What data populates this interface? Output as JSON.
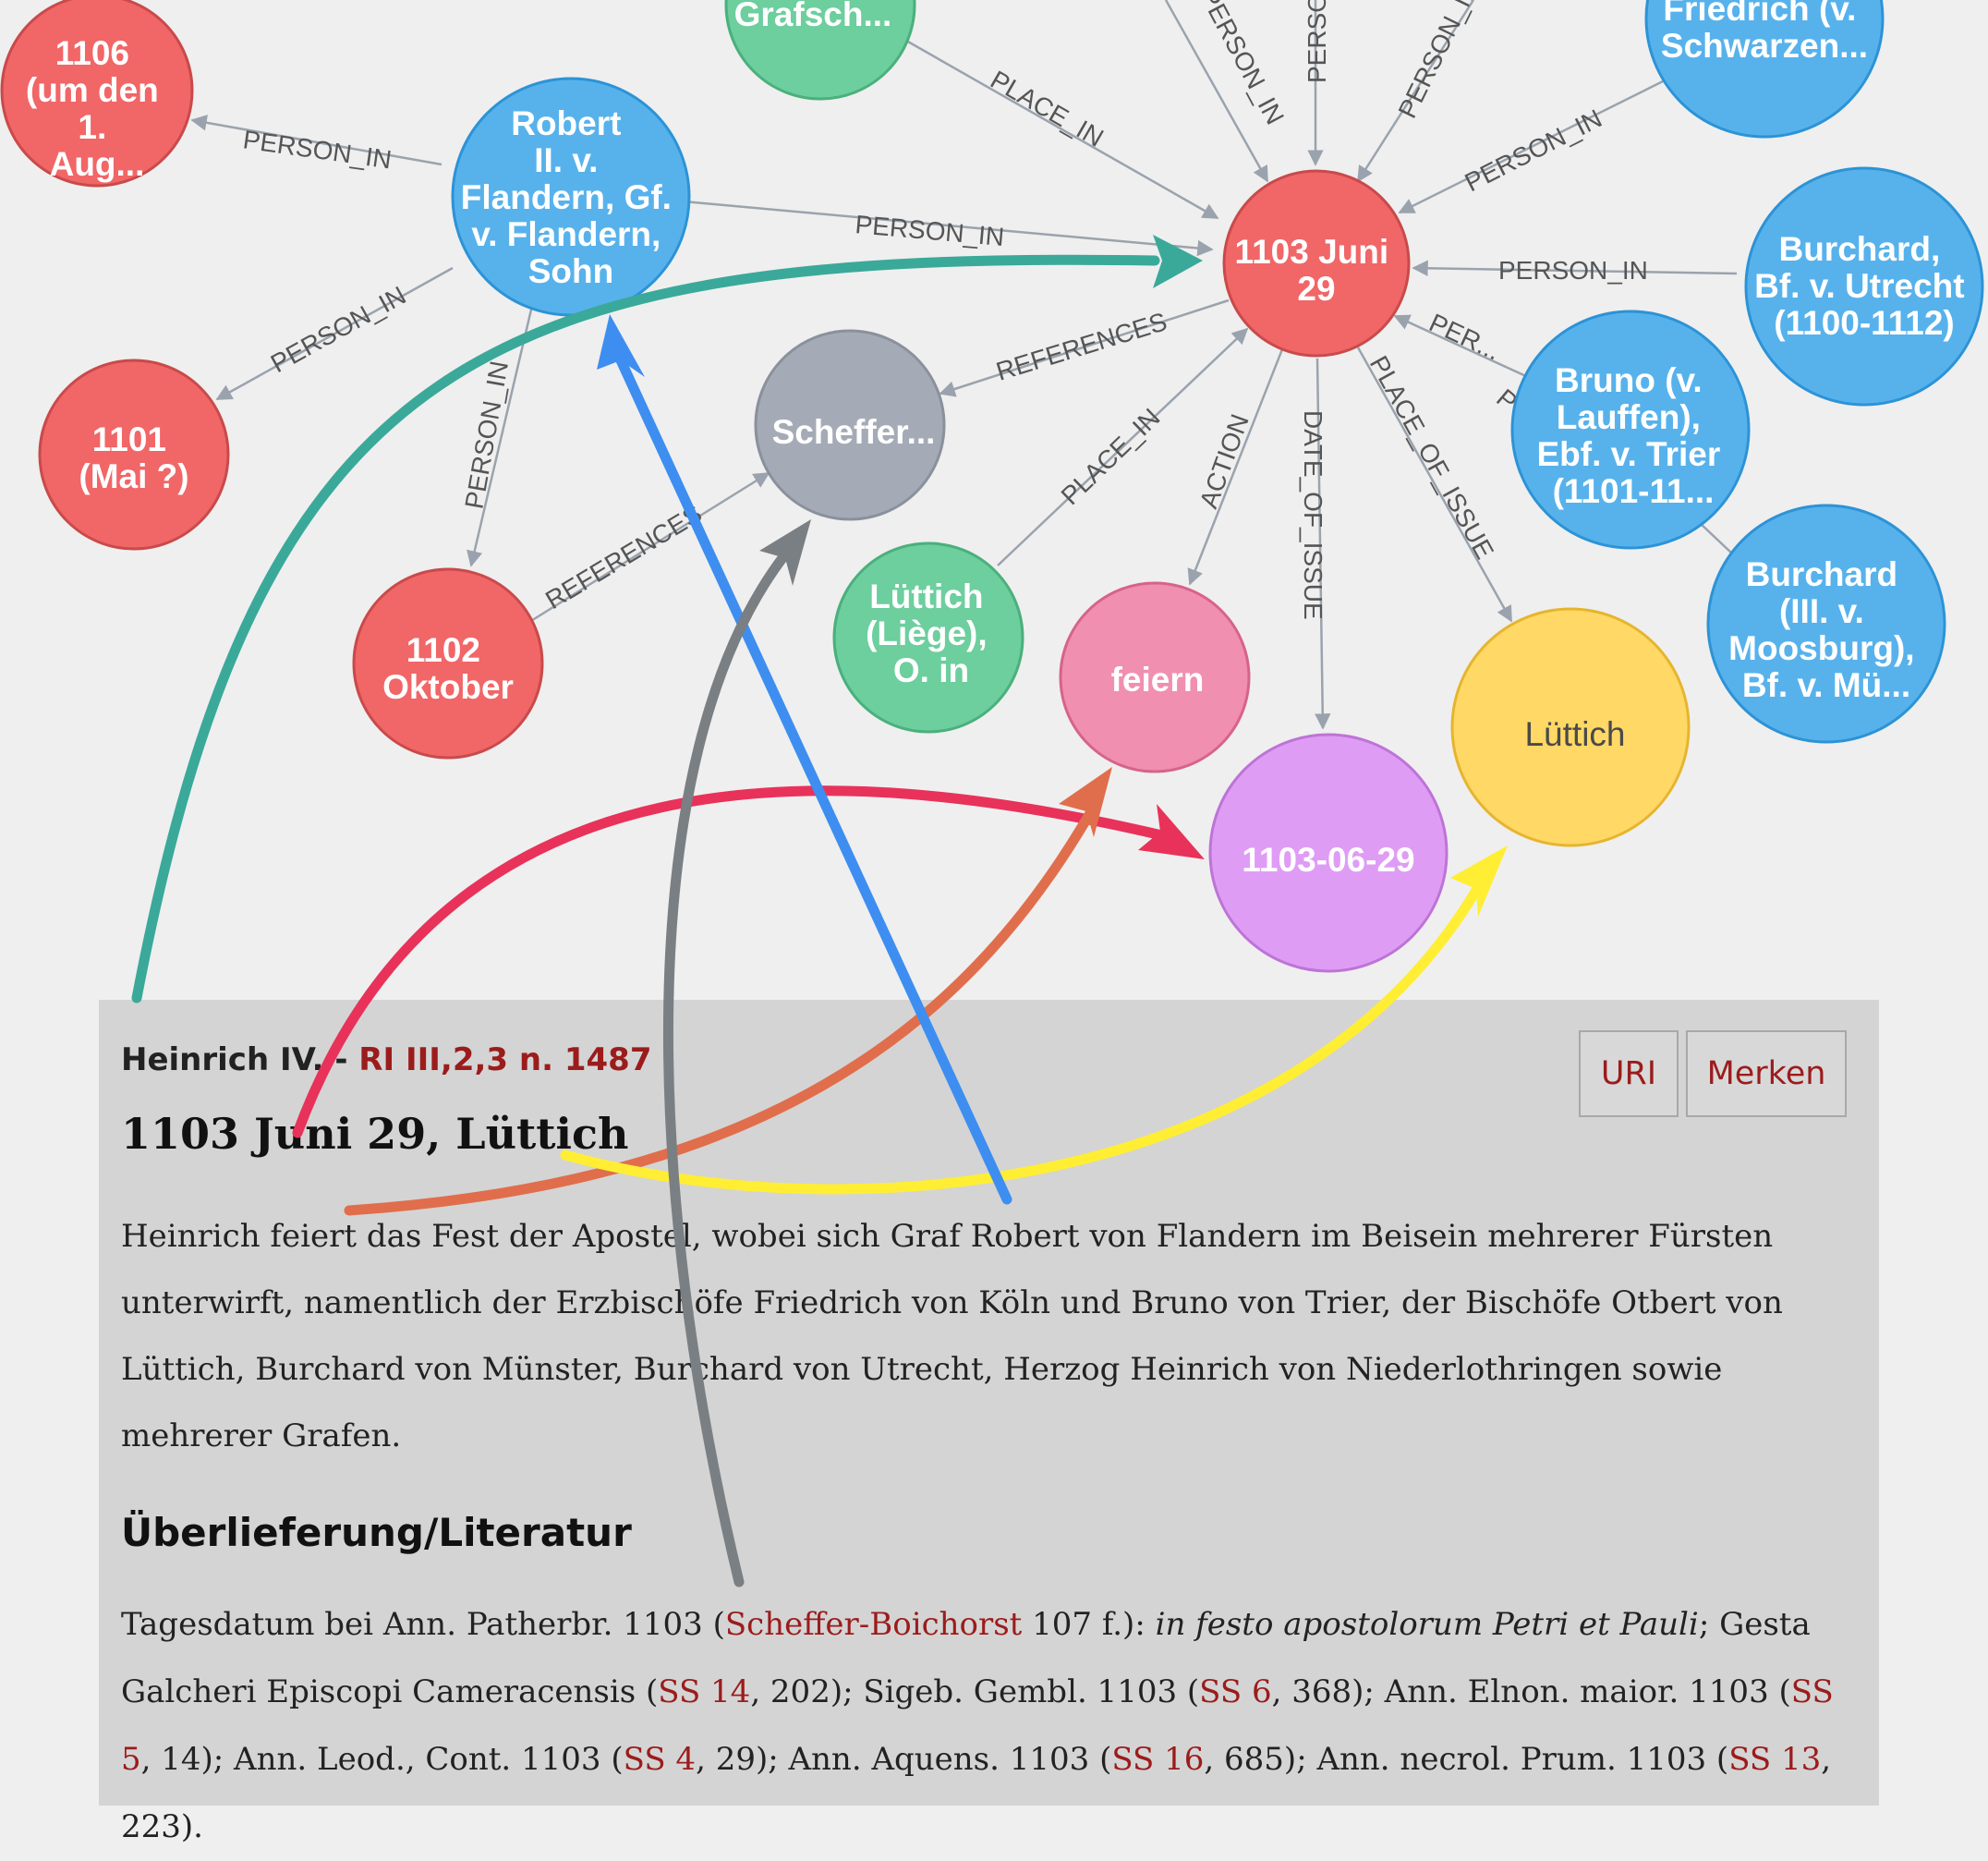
{
  "graph": {
    "nodes": [
      {
        "id": "n1106",
        "lines": [
          "1106",
          "(um den",
          "1.",
          "Aug..."
        ],
        "color": "#f16667",
        "dark": false
      },
      {
        "id": "robert",
        "lines": [
          "Robert",
          "II. v.",
          "Flandern, Gf.",
          "v. Flandern,",
          "Sohn"
        ],
        "color": "#57b2ec",
        "dark": false
      },
      {
        "id": "grafsch",
        "lines": [
          "Grafsch..."
        ],
        "color": "#6dce9e",
        "dark": false
      },
      {
        "id": "main",
        "lines": [
          "1103 Juni",
          "29"
        ],
        "color": "#f16667",
        "dark": false
      },
      {
        "id": "friedrich",
        "lines": [
          "Friedrich (v.",
          "Schwarzen..."
        ],
        "color": "#57b2ec",
        "dark": false
      },
      {
        "id": "burchard_utrecht",
        "lines": [
          "Burchard,",
          "Bf. v. Utrecht",
          "(1100-1112)"
        ],
        "color": "#57b2ec",
        "dark": false
      },
      {
        "id": "n1101",
        "lines": [
          "1101",
          "(Mai ?)"
        ],
        "color": "#f16667",
        "dark": false
      },
      {
        "id": "scheffer",
        "lines": [
          "Scheffer..."
        ],
        "color": "#a5abb6",
        "dark": false
      },
      {
        "id": "bruno",
        "lines": [
          "Bruno (v.",
          "Lauffen),",
          "Ebf. v. Trier",
          "(1101-11..."
        ],
        "color": "#57b2ec",
        "dark": false
      },
      {
        "id": "burchard_moosburg",
        "lines": [
          "Burchard",
          "(III. v.",
          "Moosburg),",
          "Bf. v. Mü..."
        ],
        "color": "#57b2ec",
        "dark": false
      },
      {
        "id": "n1102",
        "lines": [
          "1102",
          "Oktober"
        ],
        "color": "#f16667",
        "dark": false
      },
      {
        "id": "luettich_place",
        "lines": [
          "Lüttich",
          "(Liège),",
          "O. in"
        ],
        "color": "#6dce9e",
        "dark": false
      },
      {
        "id": "feiern",
        "lines": [
          "feiern"
        ],
        "color": "#f08fb0",
        "dark": false
      },
      {
        "id": "date",
        "lines": [
          "1103-06-29"
        ],
        "color": "#df9cf5",
        "dark": false
      },
      {
        "id": "luettich_issue",
        "lines": [
          "Lüttich"
        ],
        "color": "#ffd866",
        "dark": true
      }
    ],
    "edges": [
      {
        "label": "PERSON_IN"
      },
      {
        "label": "PERSON_IN"
      },
      {
        "label": "PERSON_IN"
      },
      {
        "label": "PERSON_IN"
      },
      {
        "label": "PLACE_IN"
      },
      {
        "label": "PERSON_IN"
      },
      {
        "label": "PERSON_IN"
      },
      {
        "label": "PERSON_IN"
      },
      {
        "label": "PERSON_IN"
      },
      {
        "label": "PERSON_IN"
      },
      {
        "label": "PER..."
      },
      {
        "label": "REFERENCES"
      },
      {
        "label": "REFERENCES"
      },
      {
        "label": "PLACE_IN"
      },
      {
        "label": "ACTION"
      },
      {
        "label": "DATE_OF_ISSUE"
      },
      {
        "label": "PLACE_OF_ISSUE"
      },
      {
        "label": "P"
      }
    ]
  },
  "regest": {
    "ruler": "Heinrich IV. - ",
    "ref": "RI III,2,3 n. 1487",
    "uri_button": "URI",
    "merken_button": "Merken",
    "date_place": "1103 Juni 29, Lüttich",
    "summary": "Heinrich feiert das Fest der Apostel, wobei sich Graf Robert von Flandern im Beisein mehrerer Fürsten unterwirft, namentlich der Erzbischöfe Friedrich von Köln und Bruno von Trier, der Bischöfe Otbert von Lüttich, Burchard von Münster, Burchard von Utrecht, Herzog Heinrich von Niederlothringen sowie mehrerer Grafen.",
    "section_title": "Überlieferung/Literatur",
    "sources": {
      "s1": "Tagesdatum bei Ann. Patherbr. 1103 (",
      "l1": "Scheffer-Boichorst",
      "s2": " 107 f.): ",
      "quote": "in festo apostolorum Petri et Pauli",
      "s3": "; Gesta Galcheri Episcopi Cameracensis (",
      "l2": "SS 14",
      "s4": ", 202); Sigeb. Gembl. 1103 (",
      "l3": "SS 6",
      "s5": ", 368); Ann. Elnon. maior. 1103 (",
      "l4": "SS 5",
      "s6": ", 14); Ann. Leod., Cont. 1103 (",
      "l5": "SS 4",
      "s7": ", 29); Ann. Aquens. 1103 (",
      "l6": "SS 16",
      "s8": ", 685); Ann. necrol. Prum. 1103 (",
      "l7": "SS 13",
      "s9": ", 223)."
    }
  },
  "annotation_arrows": [
    {
      "color": "#3aa99a",
      "meaning": "date-place to main node"
    },
    {
      "color": "#e8325a",
      "meaning": "date to date-of-issue node"
    },
    {
      "color": "#e06e4c",
      "meaning": "summary to action node"
    },
    {
      "color": "#ffee33",
      "meaning": "place to place-of-issue node"
    },
    {
      "color": "#3d8ef0",
      "meaning": "summary to person node"
    },
    {
      "color": "#7a7f83",
      "meaning": "reference to references node"
    }
  ]
}
